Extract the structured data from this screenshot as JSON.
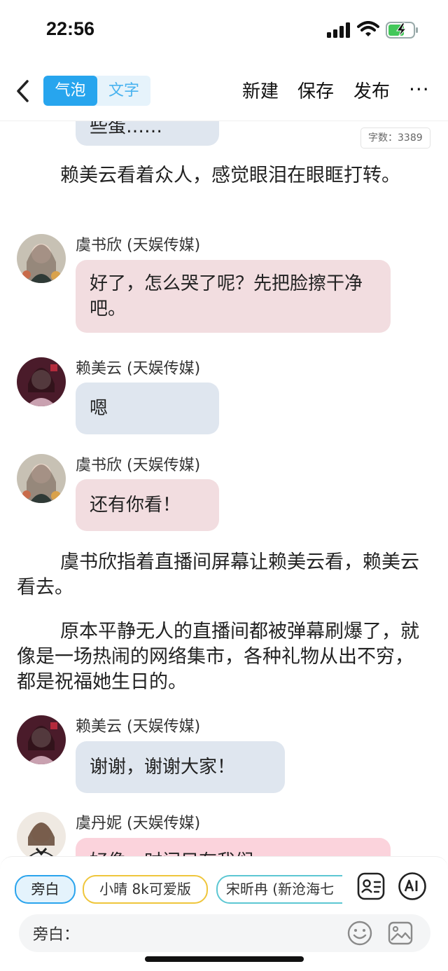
{
  "status_bar": {
    "time": "22:56"
  },
  "nav": {
    "seg_bubble": "气泡",
    "seg_text": "文字",
    "new_label": "新建",
    "save_label": "保存",
    "publish_label": "发布",
    "more_label": "···"
  },
  "word_count": "字数：3389",
  "story": {
    "cut_bubble": "些蛋……",
    "p1": "赖美云看着众人，感觉眼泪在眼眶打转。",
    "m1": {
      "name": "虞书欣 (天娱传媒)",
      "text": "好了，怎么哭了呢？先把脸擦干净吧。"
    },
    "m2": {
      "name": "赖美云 (天娱传媒)",
      "text": "嗯"
    },
    "m3": {
      "name": "虞书欣 (天娱传媒)",
      "text": "还有你看！"
    },
    "p2": "虞书欣指着直播间屏幕让赖美云看，赖美云看去。",
    "p3": "原本平静无人的直播间都被弹幕刷爆了，就像是一场热闹的网络集市，各种礼物从出不穷，都是祝福她生日的。",
    "m4": {
      "name": "赖美云 (天娱传媒)",
      "text": "谢谢，谢谢大家！"
    },
    "m5": {
      "name": "虞丹妮 (天娱传媒)",
      "text": "好像一时间只有我们。"
    }
  },
  "characters": {
    "chip1": "旁白",
    "chip2": "小晴 8k可爱版",
    "chip3": "宋昕冉 (新沧海七"
  },
  "input": {
    "label": "旁白："
  },
  "colors": {
    "accent": "#27a5ee",
    "bubble_blue": "#dfe6ef",
    "bubble_pink": "#f2dde0"
  },
  "icons": [
    "back-chevron-icon",
    "more-icon",
    "contacts-icon",
    "ai-icon",
    "emoji-icon",
    "image-icon"
  ]
}
